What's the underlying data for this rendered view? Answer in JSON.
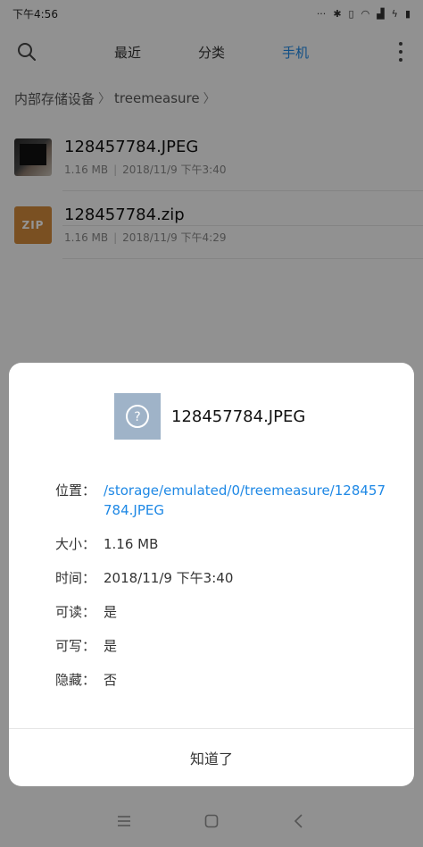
{
  "status_bar": {
    "time": "下午4:56",
    "icons": [
      "dots-icon",
      "bluetooth-icon",
      "vibrate-icon",
      "wifi-icon",
      "signal-icon",
      "charging-icon",
      "battery-icon"
    ]
  },
  "top_bar": {
    "tabs": [
      {
        "label": "最近",
        "active": false
      },
      {
        "label": "分类",
        "active": false
      },
      {
        "label": "手机",
        "active": true
      }
    ]
  },
  "breadcrumb": {
    "items": [
      "内部存储设备",
      "treemeasure"
    ]
  },
  "files": [
    {
      "name": "128457784.JPEG",
      "size": "1.16 MB",
      "date": "2018/11/9 下午3:40",
      "thumb": "photo"
    },
    {
      "name": "128457784.zip",
      "size": "1.16 MB",
      "date": "2018/11/9 下午4:29",
      "thumb": "zip",
      "thumb_label": "ZIP"
    }
  ],
  "dialog": {
    "title": "128457784.JPEG",
    "properties": [
      {
        "label": "位置：",
        "value": "/storage/emulated/0/treemeasure/128457784.JPEG",
        "link": true
      },
      {
        "label": "大小：",
        "value": "1.16 MB"
      },
      {
        "label": "时间：",
        "value": "2018/11/9 下午3:40"
      },
      {
        "label": "可读：",
        "value": "是"
      },
      {
        "label": "可写：",
        "value": "是"
      },
      {
        "label": "隐藏：",
        "value": "否"
      }
    ],
    "confirm_label": "知道了"
  },
  "colors": {
    "accent": "#1e88e5",
    "unknown_file_bg": "#9fb3c8",
    "zip_bg": "#d28a3c"
  }
}
